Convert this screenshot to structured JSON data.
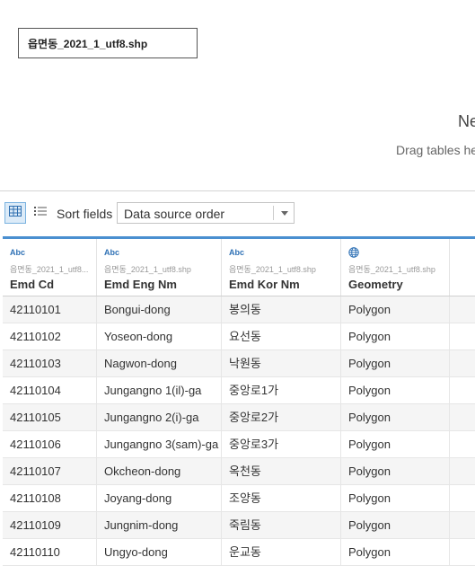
{
  "logical_table": {
    "name": "읍면동_2021_1_utf8.shp"
  },
  "canvas": {
    "title": "Ne",
    "hint": "Drag tables he"
  },
  "toolbar": {
    "grid_view_icon": "grid-view-icon",
    "list_view_icon": "list-view-icon",
    "sort_label": "Sort fields",
    "sort_value": "Data source order"
  },
  "columns": [
    {
      "type": "Abc",
      "source": "읍면동_2021_1_utf8...",
      "name": "Emd Cd"
    },
    {
      "type": "Abc",
      "source": "읍면동_2021_1_utf8.shp",
      "name": "Emd Eng Nm"
    },
    {
      "type": "Abc",
      "source": "읍면동_2021_1_utf8.shp",
      "name": "Emd Kor Nm"
    },
    {
      "type": "globe-icon",
      "source": "읍면동_2021_1_utf8.shp",
      "name": "Geometry"
    }
  ],
  "rows": [
    [
      "42110101",
      "Bongui-dong",
      "봉의동",
      "Polygon"
    ],
    [
      "42110102",
      "Yoseon-dong",
      "요선동",
      "Polygon"
    ],
    [
      "42110103",
      "Nagwon-dong",
      "낙원동",
      "Polygon"
    ],
    [
      "42110104",
      "Jungangno 1(il)-ga",
      "중앙로1가",
      "Polygon"
    ],
    [
      "42110105",
      "Jungangno 2(i)-ga",
      "중앙로2가",
      "Polygon"
    ],
    [
      "42110106",
      "Jungangno 3(sam)-ga",
      "중앙로3가",
      "Polygon"
    ],
    [
      "42110107",
      "Okcheon-dong",
      "옥천동",
      "Polygon"
    ],
    [
      "42110108",
      "Joyang-dong",
      "조양동",
      "Polygon"
    ],
    [
      "42110109",
      "Jungnim-dong",
      "죽림동",
      "Polygon"
    ],
    [
      "42110110",
      "Ungyo-dong",
      "운교동",
      "Polygon"
    ]
  ]
}
